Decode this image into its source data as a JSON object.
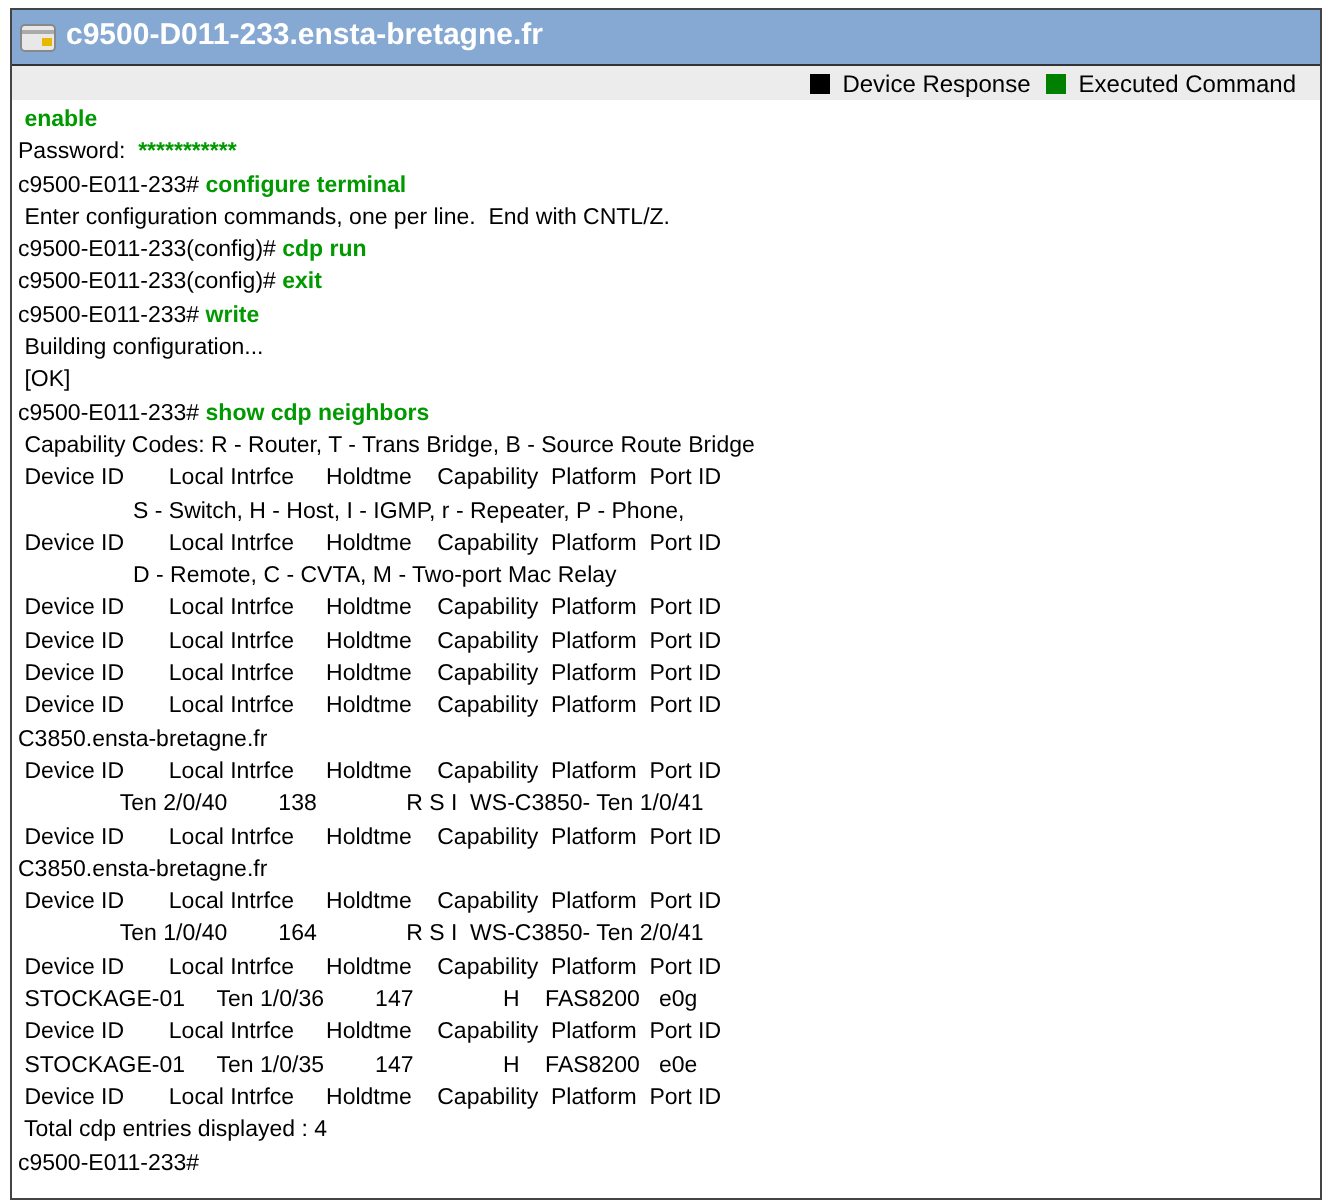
{
  "window": {
    "title": "c9500-D011-233.ensta-bretagne.fr"
  },
  "legend": [
    {
      "label": "Device Response",
      "color": "#000000"
    },
    {
      "label": "Executed Command",
      "color": "#008000"
    }
  ],
  "lines": [
    [
      {
        "kind": "command",
        "text": " enable"
      }
    ],
    [
      {
        "kind": "response",
        "text": "Password:  "
      },
      {
        "kind": "command",
        "text": "***********"
      }
    ],
    [
      {
        "kind": "response",
        "text": "c9500-E011-233# "
      },
      {
        "kind": "command",
        "text": "configure terminal"
      }
    ],
    [
      {
        "kind": "response",
        "text": " Enter configuration commands, one per line.  End with CNTL/Z."
      }
    ],
    [
      {
        "kind": "response",
        "text": "c9500-E011-233(config)# "
      },
      {
        "kind": "command",
        "text": "cdp run"
      }
    ],
    [
      {
        "kind": "response",
        "text": "c9500-E011-233(config)# "
      },
      {
        "kind": "command",
        "text": "exit"
      }
    ],
    [
      {
        "kind": "response",
        "text": "c9500-E011-233# "
      },
      {
        "kind": "command",
        "text": "write"
      }
    ],
    [
      {
        "kind": "response",
        "text": " Building configuration..."
      }
    ],
    [
      {
        "kind": "response",
        "text": " [OK]"
      }
    ],
    [
      {
        "kind": "response",
        "text": "c9500-E011-233# "
      },
      {
        "kind": "command",
        "text": "show cdp neighbors"
      }
    ],
    [
      {
        "kind": "response",
        "text": " Capability Codes: R - Router, T - Trans Bridge, B - Source Route Bridge"
      }
    ],
    [
      {
        "kind": "response",
        "text": " Device ID       Local Intrfce     Holdtme    Capability  Platform  Port ID"
      }
    ],
    [
      {
        "kind": "response",
        "text": "                  S - Switch, H - Host, I - IGMP, r - Repeater, P - Phone,"
      }
    ],
    [
      {
        "kind": "response",
        "text": " Device ID       Local Intrfce     Holdtme    Capability  Platform  Port ID"
      }
    ],
    [
      {
        "kind": "response",
        "text": "                  D - Remote, C - CVTA, M - Two-port Mac Relay"
      }
    ],
    [
      {
        "kind": "response",
        "text": " Device ID       Local Intrfce     Holdtme    Capability  Platform  Port ID"
      }
    ],
    [
      {
        "kind": "response",
        "text": " Device ID       Local Intrfce     Holdtme    Capability  Platform  Port ID"
      }
    ],
    [
      {
        "kind": "response",
        "text": " Device ID       Local Intrfce     Holdtme    Capability  Platform  Port ID"
      }
    ],
    [
      {
        "kind": "response",
        "text": " Device ID       Local Intrfce     Holdtme    Capability  Platform  Port ID"
      }
    ],
    [
      {
        "kind": "response",
        "text": "C3850.ensta-bretagne.fr"
      }
    ],
    [
      {
        "kind": "response",
        "text": " Device ID       Local Intrfce     Holdtme    Capability  Platform  Port ID"
      }
    ],
    [
      {
        "kind": "response",
        "text": "                Ten 2/0/40        138              R S I  WS-C3850- Ten 1/0/41"
      }
    ],
    [
      {
        "kind": "response",
        "text": " Device ID       Local Intrfce     Holdtme    Capability  Platform  Port ID"
      }
    ],
    [
      {
        "kind": "response",
        "text": "C3850.ensta-bretagne.fr"
      }
    ],
    [
      {
        "kind": "response",
        "text": " Device ID       Local Intrfce     Holdtme    Capability  Platform  Port ID"
      }
    ],
    [
      {
        "kind": "response",
        "text": "                Ten 1/0/40        164              R S I  WS-C3850- Ten 2/0/41"
      }
    ],
    [
      {
        "kind": "response",
        "text": " Device ID       Local Intrfce     Holdtme    Capability  Platform  Port ID"
      }
    ],
    [
      {
        "kind": "response",
        "text": " STOCKAGE-01     Ten 1/0/36        147              H    FAS8200   e0g"
      }
    ],
    [
      {
        "kind": "response",
        "text": " Device ID       Local Intrfce     Holdtme    Capability  Platform  Port ID"
      }
    ],
    [
      {
        "kind": "response",
        "text": " STOCKAGE-01     Ten 1/0/35        147              H    FAS8200   e0e"
      }
    ],
    [
      {
        "kind": "response",
        "text": " Device ID       Local Intrfce     Holdtme    Capability  Platform  Port ID"
      }
    ],
    [
      {
        "kind": "response",
        "text": " Total cdp entries displayed : 4"
      }
    ],
    [
      {
        "kind": "response",
        "text": "c9500-E011-233#"
      }
    ]
  ]
}
